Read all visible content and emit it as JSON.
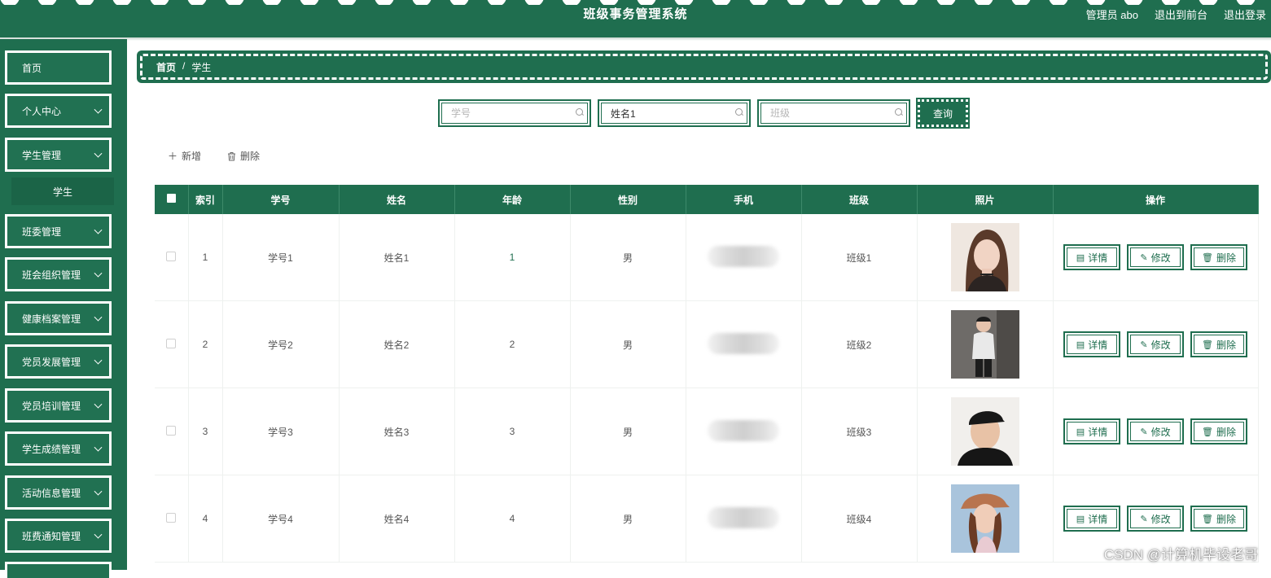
{
  "app": {
    "title": "班级事务管理系统",
    "user_label": "管理员 abo",
    "back_front_label": "退出到前台",
    "logout_label": "退出登录"
  },
  "sidebar": {
    "items": [
      {
        "label": "首页"
      },
      {
        "label": "个人中心"
      },
      {
        "label": "学生管理"
      },
      {
        "label": "学生"
      },
      {
        "label": "班委管理"
      },
      {
        "label": "班会组织管理"
      },
      {
        "label": "健康档案管理"
      },
      {
        "label": "党员发展管理"
      },
      {
        "label": "党员培训管理"
      },
      {
        "label": "学生成绩管理"
      },
      {
        "label": "活动信息管理"
      },
      {
        "label": "班费通知管理"
      }
    ]
  },
  "breadcrumb": {
    "home": "首页",
    "separator": "/",
    "current": "学生"
  },
  "search": {
    "student_no_placeholder": "学号",
    "name_value": "姓名1",
    "class_placeholder": "班级",
    "query_label": "查询"
  },
  "actions": {
    "add_label": "新增",
    "delete_label": "删除"
  },
  "table": {
    "headers": [
      "索引",
      "学号",
      "姓名",
      "年龄",
      "性别",
      "手机",
      "班级",
      "照片",
      "操作"
    ],
    "rows": [
      {
        "index": "1",
        "student_no": "学号1",
        "name": "姓名1",
        "age": "1",
        "gender": "男",
        "class": "班级1"
      },
      {
        "index": "2",
        "student_no": "学号2",
        "name": "姓名2",
        "age": "2",
        "gender": "男",
        "class": "班级2"
      },
      {
        "index": "3",
        "student_no": "学号3",
        "name": "姓名3",
        "age": "3",
        "gender": "男",
        "class": "班级3"
      },
      {
        "index": "4",
        "student_no": "学号4",
        "name": "姓名4",
        "age": "4",
        "gender": "男",
        "class": "班级4"
      }
    ],
    "op_labels": {
      "detail": "详情",
      "edit": "修改",
      "delete": "删除"
    }
  },
  "watermark": "CSDN @计算机毕设老哥",
  "colors": {
    "primary": "#1f6e4f",
    "header_text": "#ffffff"
  }
}
